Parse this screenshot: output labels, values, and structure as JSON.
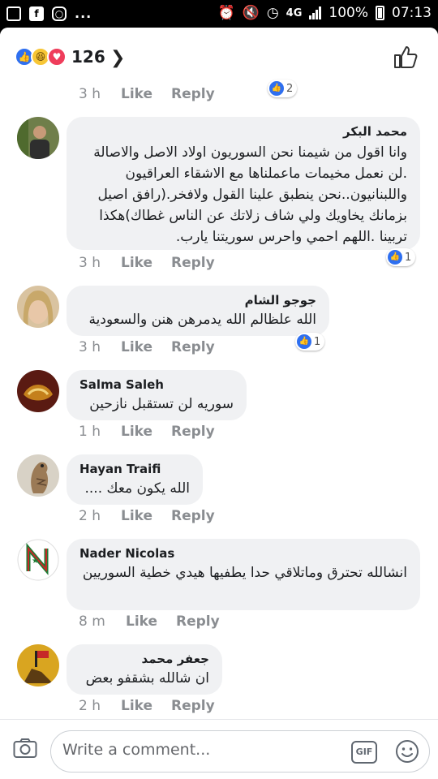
{
  "status_bar": {
    "battery": "100%",
    "time": "07:13",
    "network": "4G",
    "dots": "..."
  },
  "reactions": {
    "count": "126",
    "types": [
      "like-icon",
      "haha-icon",
      "love-icon"
    ]
  },
  "partial_comment": {
    "time": "3 h",
    "like": "Like",
    "reply": "Reply",
    "reactions": "2"
  },
  "comments": [
    {
      "name": "محمد البكر",
      "text": "وانا اقول من شيمنا نحن السوريون اولاد الاصل والاصالة .لن نعمل مخيمات ماعملناها مع الاشقاء العراقيون واللبنانيون..نحن ينطبق علينا القول ولافخر.(رافق اصيل بزمانك يخاويك ولي شاف زلاتك عن الناس غطاك)هكذا تربينا .اللهم احمي واحرس سوريتنا يارب.",
      "time": "3 h",
      "like": "Like",
      "reply": "Reply",
      "reactions": "1"
    },
    {
      "name": "جوجو الشام",
      "text": "الله علظالم الله يدمرهن هنن والسعودية",
      "time": "3 h",
      "like": "Like",
      "reply": "Reply",
      "reactions": "1"
    },
    {
      "name": "Salma Saleh",
      "text": "سوريه لن تستقبل نازحين",
      "time": "1 h",
      "like": "Like",
      "reply": "Reply"
    },
    {
      "name": "Hayan Traifi",
      "text": "الله يكون معك ....",
      "time": "2 h",
      "like": "Like",
      "reply": "Reply"
    },
    {
      "name": "Nader Nicolas",
      "text": "انشالله تحترق وماتلاقي حدا يطفيها هيدي خطية السوريين",
      "time": "8 m",
      "like": "Like",
      "reply": "Reply"
    },
    {
      "name": "جعفر محمد",
      "text": "ان شالله بشقفو بعض",
      "time": "2 h",
      "like": "Like",
      "reply": "Reply"
    }
  ],
  "composer": {
    "placeholder": "Write a comment...",
    "gif_label": "GIF"
  },
  "colors": {
    "facebook_blue": "#2e6ff0",
    "bubble": "#f0f1f3",
    "meta_grey": "#8a8d91"
  }
}
